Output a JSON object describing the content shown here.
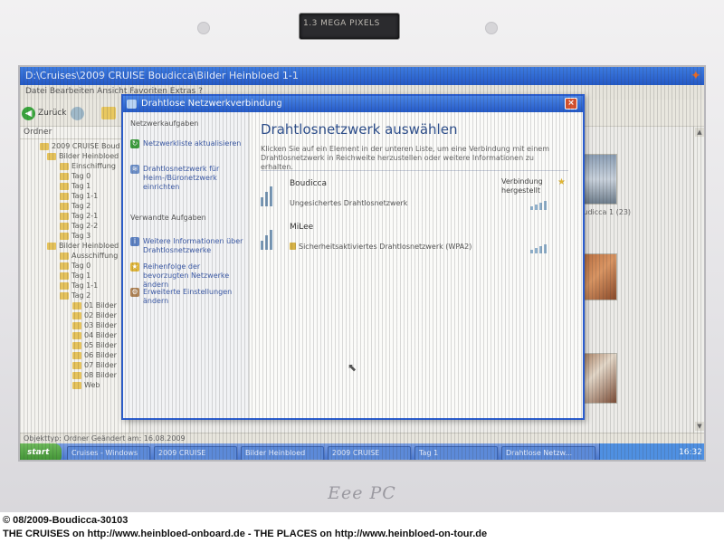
{
  "bezel": {
    "webcam_label": "1.3 MEGA PIXELS",
    "brand": "Eee PC"
  },
  "explorer": {
    "title": "D:\\Cruises\\2009 CRUISE Boudicca\\Bilder Heinbloed 1-1",
    "menu": "Datei   Bearbeiten   Ansicht   Favoriten   Extras   ?",
    "back_label": "Zurück",
    "pane_header": "Ordner",
    "tree": [
      "2009 CRUISE Boud",
      "Bilder Heinbloed",
      "Einschiffung",
      "Tag 0",
      "Tag 1",
      "Tag 1-1",
      "Tag 2",
      "Tag 2-1",
      "Tag 2-2",
      "Tag 3",
      "Bilder Heinbloed",
      "Ausschiffung",
      "Tag 0",
      "Tag 1",
      "Tag 1-1",
      "Tag 2",
      "01 Bilder",
      "02 Bilder",
      "03 Bilder",
      "04 Bilder",
      "05 Bilder",
      "06 Bilder",
      "07 Bilder",
      "08 Bilder",
      "Web"
    ],
    "thumb_caption": "Boudicca 1 (23)",
    "status_text": "Objekttyp: Ordner   Geändert am: 16.08.2009"
  },
  "dialog": {
    "title": "Drahtlose Netzwerkverbindung",
    "close_label": "×",
    "tasks_heading": "Netzwerkaufgaben",
    "tasks": [
      "Netzwerkliste aktualisieren",
      "Drahtlosnetzwerk für Heim-/Büronetzwerk einrichten"
    ],
    "related_heading": "Verwandte Aufgaben",
    "related": [
      "Weitere Informationen über Drahtlosnetzwerke",
      "Reihenfolge der bevorzugten Netzwerke ändern",
      "Erweiterte Einstellungen ändern"
    ],
    "main_heading": "Drahtlosnetzwerk auswählen",
    "description": "Klicken Sie auf ein Element in der unteren Liste, um eine Verbindung mit einem Drahtlosnetzwerk in Reichweite herzustellen oder weitere Informationen zu erhalten.",
    "networks": [
      {
        "name": "Boudicca",
        "security": "Ungesichertes Drahtlosnetzwerk",
        "status": "Verbindung hergestellt"
      },
      {
        "name": "MiLee",
        "security": "Sicherheitsaktiviertes Drahtlosnetzwerk (WPA2)",
        "status": ""
      }
    ]
  },
  "taskbar": {
    "start_label": "start",
    "tasks": [
      "Cruises - Windows",
      "2009 CRUISE",
      "Bilder Heinbloed",
      "2009 CRUISE",
      "Tag 1",
      "Drahtlose Netzw..."
    ],
    "clock": "16:32"
  },
  "caption": {
    "line1": "© 08/2009-Boudicca-30103",
    "line2": "THE CRUISES on http://www.heinbloed-onboard.de - THE PLACES on http://www.heinbloed-on-tour.de"
  }
}
